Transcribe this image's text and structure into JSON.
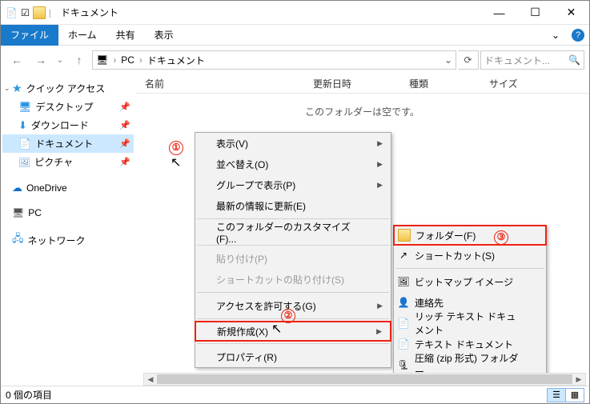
{
  "title": "ドキュメント",
  "winbtn": {
    "min": "—",
    "max": "☐",
    "close": "✕"
  },
  "ribbon": {
    "file": "ファイル",
    "home": "ホーム",
    "share": "共有",
    "view": "表示",
    "expand": "⌄",
    "help": "?"
  },
  "nav": {
    "back": "←",
    "fwd": "→",
    "recent": "⌄",
    "up": "↑"
  },
  "address": {
    "root": "PC",
    "sep": "›",
    "folder": "ドキュメント",
    "dropdown": "⌄",
    "refresh": "⟳"
  },
  "search": {
    "placeholder": "ドキュメント..."
  },
  "sidebar": {
    "quick": "クイック アクセス",
    "desktop": "デスクトップ",
    "downloads": "ダウンロード",
    "documents": "ドキュメント",
    "pictures": "ピクチャ",
    "onedrive": "OneDrive",
    "pc": "PC",
    "network": "ネットワーク"
  },
  "columns": {
    "name": "名前",
    "date": "更新日時",
    "type": "種類",
    "size": "サイズ"
  },
  "empty_msg": "このフォルダーは空です。",
  "menu1": {
    "view": "表示(V)",
    "sort": "並べ替え(O)",
    "group": "グループで表示(P)",
    "refresh": "最新の情報に更新(E)",
    "customize": "このフォルダーのカスタマイズ(F)...",
    "paste": "貼り付け(P)",
    "paste_shortcut": "ショートカットの貼り付け(S)",
    "access": "アクセスを許可する(G)",
    "new": "新規作成(X)",
    "properties": "プロパティ(R)"
  },
  "menu2": {
    "folder": "フォルダー(F)",
    "shortcut": "ショートカット(S)",
    "bitmap": "ビットマップ イメージ",
    "contact": "連絡先",
    "rtf": "リッチ テキスト ドキュメント",
    "txt": "テキスト ドキュメント",
    "zip": "圧縮 (zip 形式) フォルダー"
  },
  "status": {
    "items": "0 個の項目"
  },
  "anno": {
    "n1": "①",
    "n2": "②",
    "n3": "③"
  }
}
